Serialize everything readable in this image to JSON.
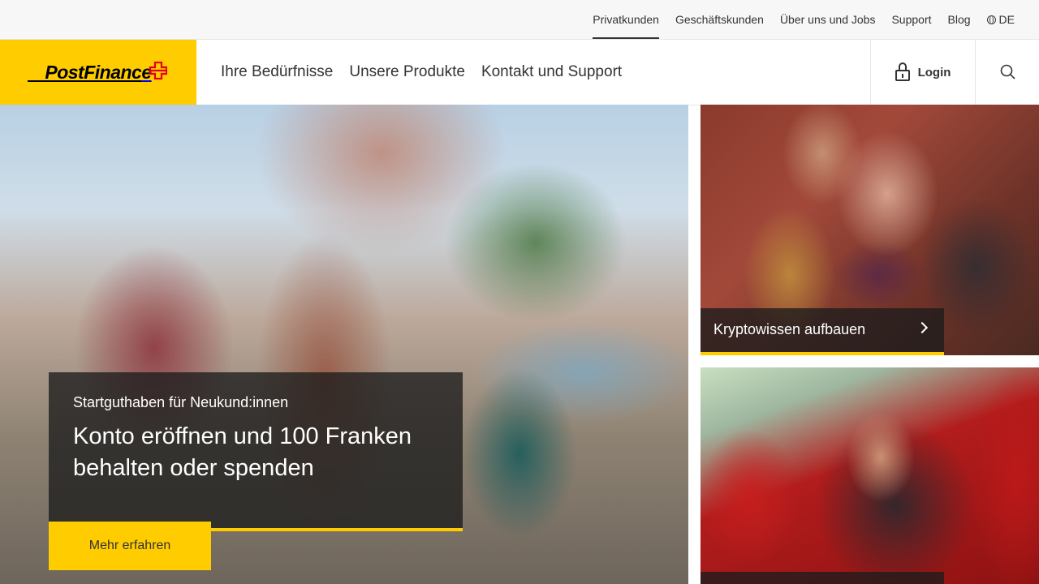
{
  "topbar": {
    "links": [
      {
        "label": "Privatkunden",
        "active": true
      },
      {
        "label": "Geschäftskunden",
        "active": false
      },
      {
        "label": "Über uns und Jobs",
        "active": false
      },
      {
        "label": "Support",
        "active": false
      },
      {
        "label": "Blog",
        "active": false
      }
    ],
    "language": "DE"
  },
  "header": {
    "logo_text": "PostFinance",
    "nav": [
      "Ihre Bedürfnisse",
      "Unsere Produkte",
      "Kontakt und Support"
    ],
    "login_label": "Login"
  },
  "hero": {
    "eyebrow": "Startguthaben für Neukund:innen",
    "title": "Konto eröffnen und 100 Franken behalten oder spenden",
    "button_label": "Mehr erfahren"
  },
  "tiles": [
    {
      "caption": "Kryptowissen aufbauen"
    }
  ],
  "colors": {
    "brand_yellow": "#ffcc00",
    "brand_orange": "#f59a00",
    "overlay": "#1c1c1c"
  },
  "icons": [
    "globe-icon",
    "lock-icon",
    "search-icon",
    "chevron-right-icon",
    "swiss-cross-icon"
  ]
}
